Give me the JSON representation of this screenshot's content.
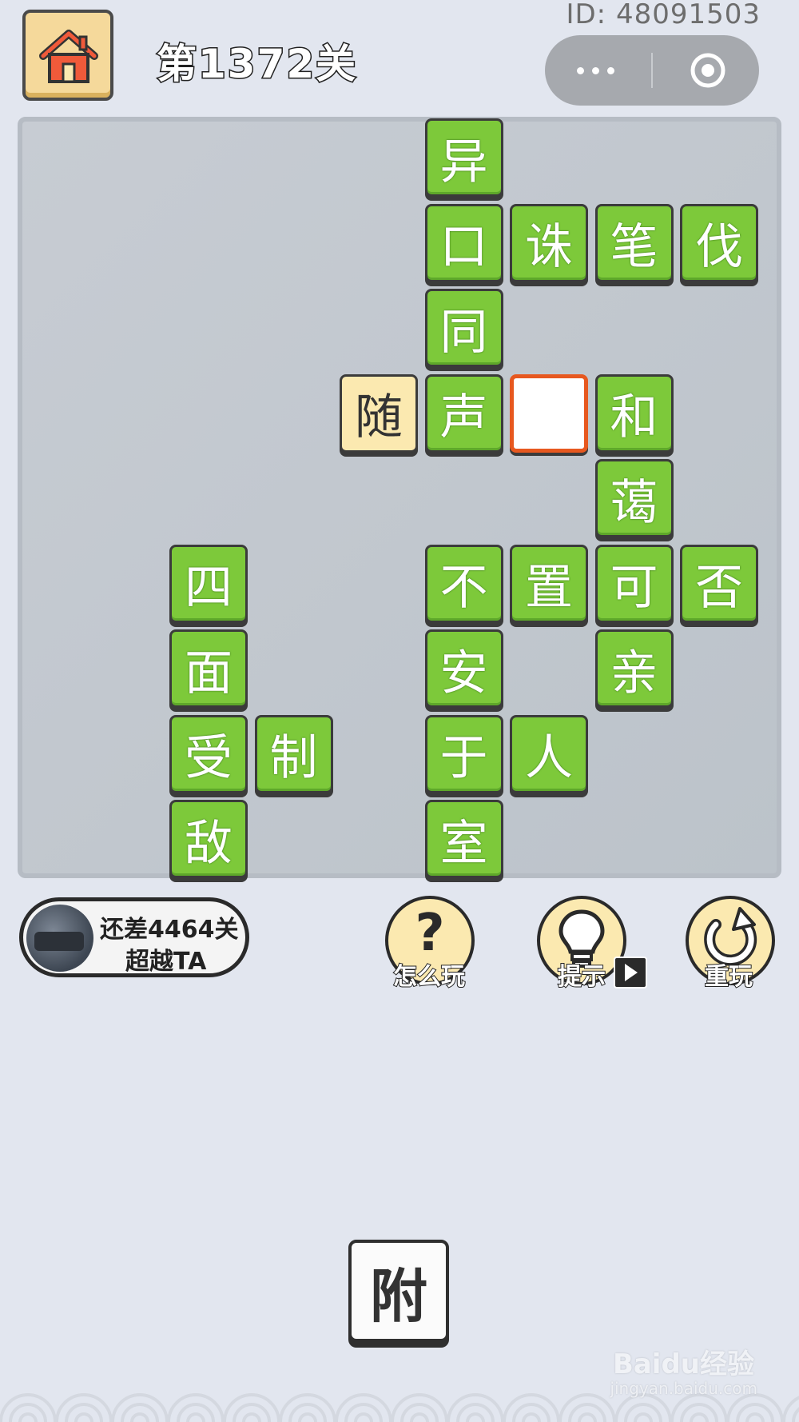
{
  "header": {
    "user_id": "ID: 48091503",
    "level_title": "第1372关"
  },
  "board": {
    "grid": [
      {
        "row": 0,
        "col": 4,
        "char": "异",
        "style": "green"
      },
      {
        "row": 1,
        "col": 4,
        "char": "口",
        "style": "green"
      },
      {
        "row": 1,
        "col": 5,
        "char": "诛",
        "style": "green"
      },
      {
        "row": 1,
        "col": 6,
        "char": "笔",
        "style": "green"
      },
      {
        "row": 1,
        "col": 7,
        "char": "伐",
        "style": "green"
      },
      {
        "row": 2,
        "col": 4,
        "char": "同",
        "style": "green"
      },
      {
        "row": 3,
        "col": 3,
        "char": "随",
        "style": "yellow"
      },
      {
        "row": 3,
        "col": 4,
        "char": "声",
        "style": "green"
      },
      {
        "row": 3,
        "col": 5,
        "char": "",
        "style": "blank"
      },
      {
        "row": 3,
        "col": 6,
        "char": "和",
        "style": "green"
      },
      {
        "row": 4,
        "col": 6,
        "char": "蔼",
        "style": "green"
      },
      {
        "row": 5,
        "col": 1,
        "char": "四",
        "style": "green"
      },
      {
        "row": 5,
        "col": 4,
        "char": "不",
        "style": "green"
      },
      {
        "row": 5,
        "col": 5,
        "char": "置",
        "style": "green"
      },
      {
        "row": 5,
        "col": 6,
        "char": "可",
        "style": "green"
      },
      {
        "row": 5,
        "col": 7,
        "char": "否",
        "style": "green"
      },
      {
        "row": 6,
        "col": 1,
        "char": "面",
        "style": "green"
      },
      {
        "row": 6,
        "col": 4,
        "char": "安",
        "style": "green"
      },
      {
        "row": 6,
        "col": 6,
        "char": "亲",
        "style": "green"
      },
      {
        "row": 7,
        "col": 1,
        "char": "受",
        "style": "green"
      },
      {
        "row": 7,
        "col": 2,
        "char": "制",
        "style": "green"
      },
      {
        "row": 7,
        "col": 4,
        "char": "于",
        "style": "green"
      },
      {
        "row": 7,
        "col": 5,
        "char": "人",
        "style": "green"
      },
      {
        "row": 8,
        "col": 1,
        "char": "敌",
        "style": "green"
      },
      {
        "row": 8,
        "col": 4,
        "char": "室",
        "style": "green"
      }
    ]
  },
  "rank": {
    "line1": "还差4464关",
    "line2": "超越TA"
  },
  "actions": {
    "help_label": "怎么玩",
    "help_glyph": "?",
    "hint_label": "提示",
    "replay_label": "重玩"
  },
  "candidates": [
    "附"
  ],
  "watermark": {
    "brand": "Baidu经验",
    "url": "jingyan.baidu.com"
  },
  "colors": {
    "tile_green": "#7dc93a",
    "tile_yellow": "#fbe9b0",
    "blank_border": "#e7581f",
    "background": "#e2e6ef"
  }
}
